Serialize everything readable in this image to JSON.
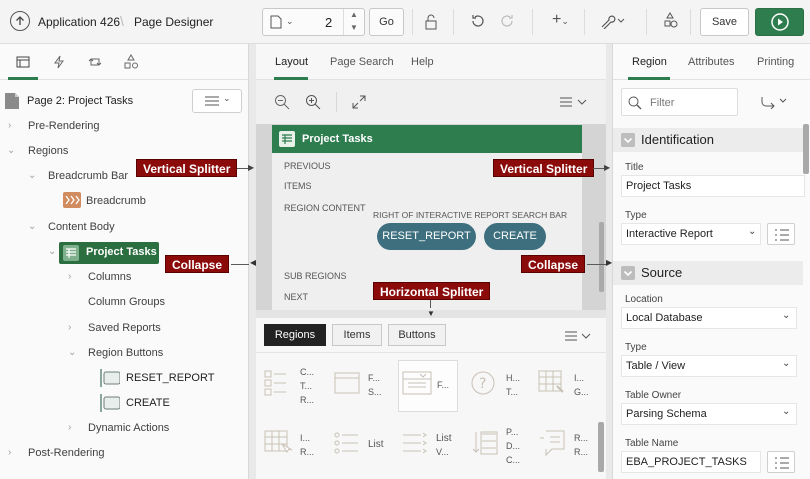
{
  "app": {
    "name": "Application 426",
    "page_designer": "Page Designer"
  },
  "toolbar": {
    "page_number": "2",
    "go_label": "Go",
    "save_label": "Save"
  },
  "left": {
    "page_title": "Page 2: Project Tasks",
    "tree": {
      "pre_rendering": "Pre-Rendering",
      "regions": "Regions",
      "breadcrumb_bar": "Breadcrumb Bar",
      "breadcrumb": "Breadcrumb",
      "content_body": "Content Body",
      "project_tasks": "Project Tasks",
      "columns": "Columns",
      "column_groups": "Column Groups",
      "saved_reports": "Saved Reports",
      "region_buttons": "Region Buttons",
      "reset_report": "RESET_REPORT",
      "create": "CREATE",
      "dynamic_actions": "Dynamic Actions",
      "post_rendering": "Post-Rendering"
    }
  },
  "center": {
    "tabs": [
      "Layout",
      "Page Search",
      "Help"
    ],
    "region_title": "Project Tasks",
    "positions": {
      "previous": "PREVIOUS",
      "items": "ITEMS",
      "region_content": "REGION CONTENT",
      "right_of_ir": "RIGHT OF INTERACTIVE REPORT SEARCH BAR",
      "sub_regions": "SUB REGIONS",
      "next": "NEXT"
    },
    "buttons": {
      "reset": "RESET_REPORT",
      "create": "CREATE"
    },
    "gallery_tabs": [
      "Regions",
      "Items",
      "Buttons"
    ],
    "gallery": [
      {
        "lines": [
          "C...",
          "T...",
          "R..."
        ]
      },
      {
        "lines": [
          "F...",
          "S..."
        ]
      },
      {
        "lines": [
          "F..."
        ]
      },
      {
        "lines": [
          "H...",
          "T..."
        ]
      },
      {
        "lines": [
          "I...",
          "G..."
        ]
      },
      {
        "lines": [
          "I...",
          "R..."
        ]
      },
      {
        "lines": [
          "List"
        ]
      },
      {
        "lines": [
          "List",
          "V..."
        ]
      },
      {
        "lines": [
          "P...",
          "D...",
          "C..."
        ]
      },
      {
        "lines": [
          "R...",
          "R..."
        ]
      }
    ]
  },
  "right": {
    "tabs": [
      "Region",
      "Attributes",
      "Printing"
    ],
    "filter_placeholder": "Filter",
    "identification": {
      "heading": "Identification",
      "title_label": "Title",
      "title_value": "Project Tasks",
      "type_label": "Type",
      "type_value": "Interactive Report"
    },
    "source": {
      "heading": "Source",
      "location_label": "Location",
      "location_value": "Local Database",
      "type_label": "Type",
      "type_value": "Table / View",
      "owner_label": "Table Owner",
      "owner_value": "Parsing Schema",
      "table_label": "Table Name",
      "table_value": "EBA_PROJECT_TASKS"
    }
  },
  "callouts": {
    "vsplit_left": "Vertical Splitter",
    "vsplit_right": "Vertical Splitter",
    "collapse_left": "Collapse",
    "collapse_right": "Collapse",
    "hsplit": "Horizontal Splitter"
  },
  "colors": {
    "accent_green": "#2e7d4f",
    "dark_green": "#2b6e3f",
    "button_teal": "#3d6f7e",
    "callout_red": "#8b0b0b"
  }
}
